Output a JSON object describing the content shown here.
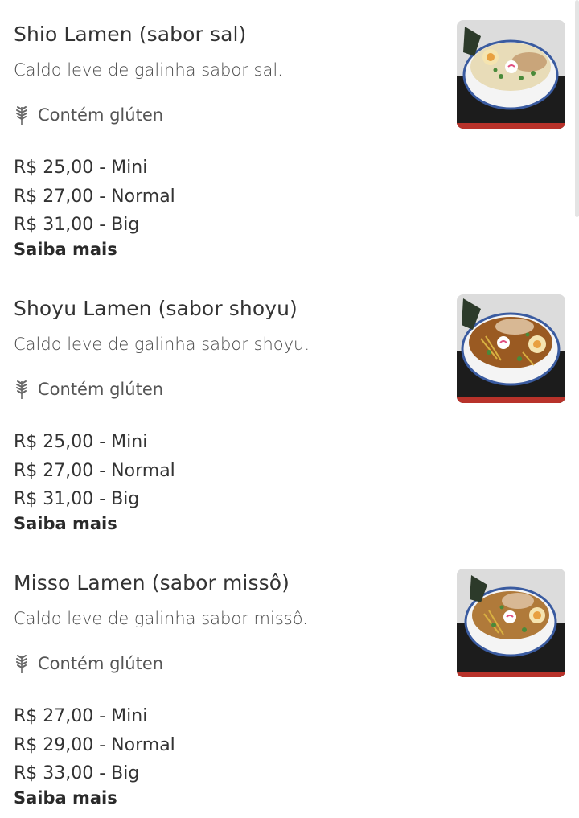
{
  "menu": {
    "items": [
      {
        "title": "Shio Lamen (sabor sal)",
        "description": "Caldo leve de galinha sabor sal.",
        "tag": "Contém glúten",
        "prices": [
          "R$ 25,00 - Mini",
          "R$ 27,00 - Normal",
          "R$ 31,00 - Big"
        ],
        "more": "Saiba mais",
        "image": "shio-ramen-bowl"
      },
      {
        "title": "Shoyu Lamen (sabor shoyu)",
        "description": "Caldo leve de galinha sabor shoyu.",
        "tag": "Contém glúten",
        "prices": [
          "R$ 25,00 - Mini",
          "R$ 27,00 - Normal",
          "R$ 31,00 - Big"
        ],
        "more": "Saiba mais",
        "image": "shoyu-ramen-bowl"
      },
      {
        "title": "Misso Lamen (sabor missô)",
        "description": "Caldo leve de galinha sabor missô.",
        "tag": "Contém glúten",
        "prices": [
          "R$ 27,00 - Mini",
          "R$ 29,00 - Normal",
          "R$ 33,00 - Big"
        ],
        "more": "Saiba mais",
        "image": "misso-ramen-bowl"
      }
    ]
  },
  "icons": {
    "gluten": "wheat-icon"
  },
  "colors": {
    "text": "#333333",
    "muted": "#555555",
    "shio_broth": "#e8dcb8",
    "shoyu_broth": "#9a5a22",
    "misso_broth": "#b07a3a",
    "tray": "#1c1c1c",
    "tray_rim": "#b8322a"
  }
}
